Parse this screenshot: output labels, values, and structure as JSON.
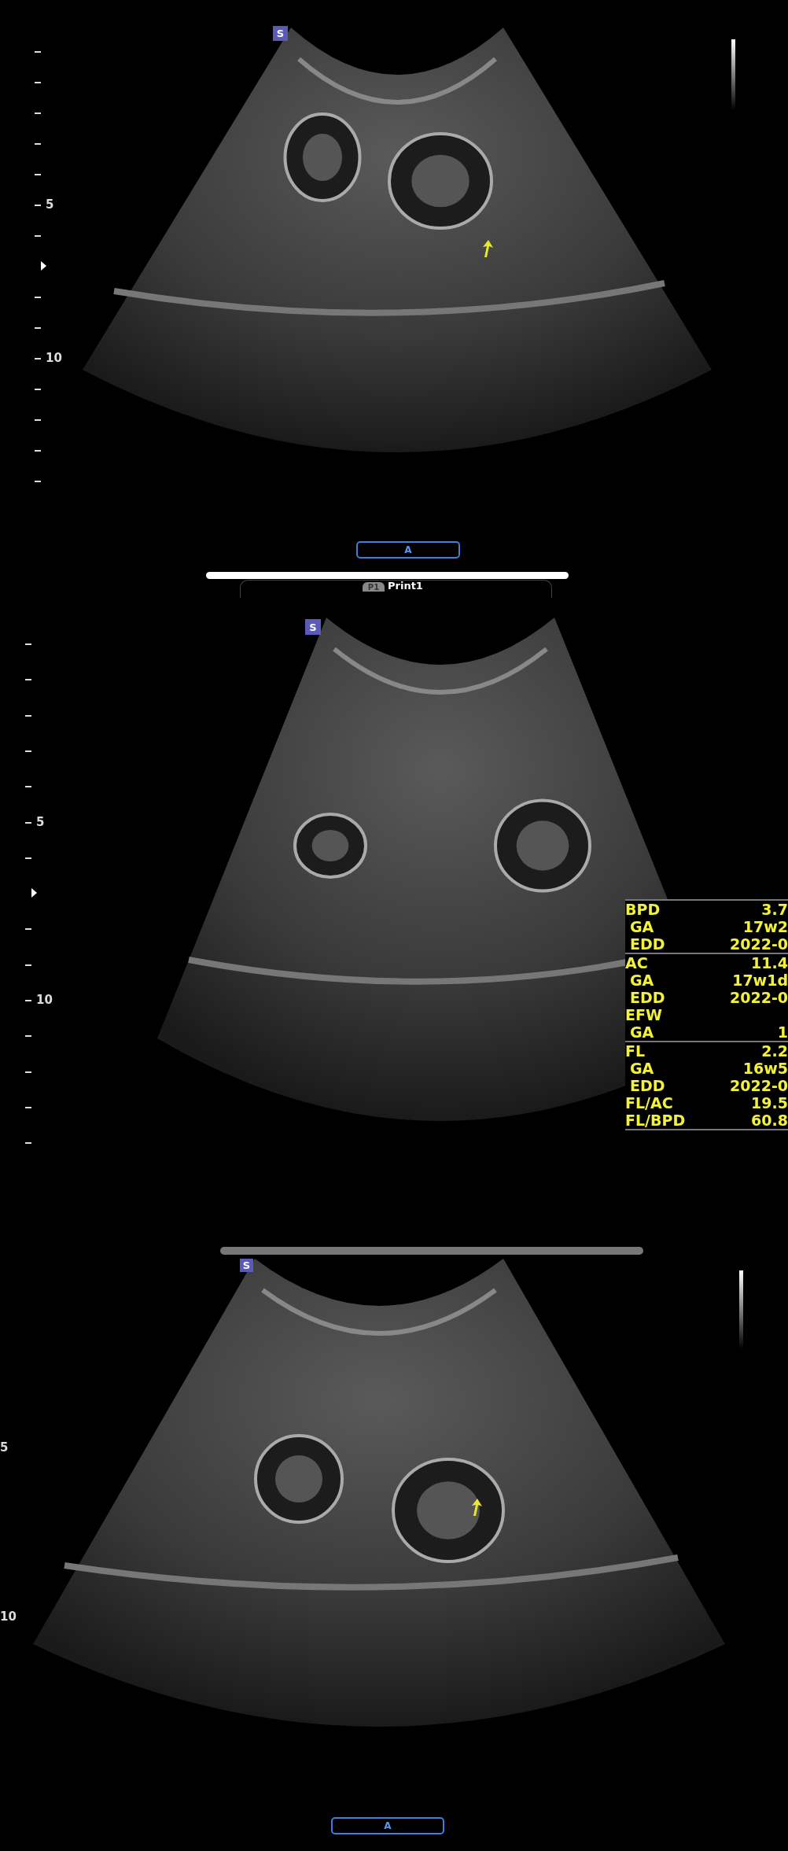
{
  "panels": [
    {
      "badge": "S",
      "depth_scale": {
        "labels": [
          "5",
          "10"
        ]
      },
      "mode_button": "A"
    },
    {
      "badge": "S",
      "depth_scale": {
        "labels": [
          "5",
          "10"
        ]
      },
      "measurements": [
        {
          "rows": [
            {
              "label": "BPD",
              "value": "3.7",
              "kind": "main"
            },
            {
              "label": "GA",
              "value": "17w2",
              "kind": "sub"
            },
            {
              "label": "EDD",
              "value": "2022-0",
              "kind": "sub"
            }
          ]
        },
        {
          "rows": [
            {
              "label": "AC",
              "value": "11.4",
              "kind": "main"
            },
            {
              "label": "GA",
              "value": "17w1d",
              "kind": "sub"
            },
            {
              "label": "EDD",
              "value": "2022-0",
              "kind": "sub"
            },
            {
              "label": "EFW",
              "value": "",
              "kind": "main"
            },
            {
              "label": "GA",
              "value": "1",
              "kind": "sub"
            }
          ]
        },
        {
          "rows": [
            {
              "label": "FL",
              "value": "2.2",
              "kind": "main"
            },
            {
              "label": "GA",
              "value": "16w5",
              "kind": "sub"
            },
            {
              "label": "EDD",
              "value": "2022-0",
              "kind": "sub"
            },
            {
              "label": "FL/AC",
              "value": "19.5",
              "kind": "main"
            },
            {
              "label": "FL/BPD",
              "value": "60.8",
              "kind": "main"
            }
          ]
        }
      ]
    },
    {
      "badge": "S",
      "depth_scale": {
        "labels": [
          "5",
          "10"
        ]
      },
      "mode_button": "A"
    }
  ],
  "print_tab": {
    "badge": "P1",
    "label": "Print1"
  }
}
